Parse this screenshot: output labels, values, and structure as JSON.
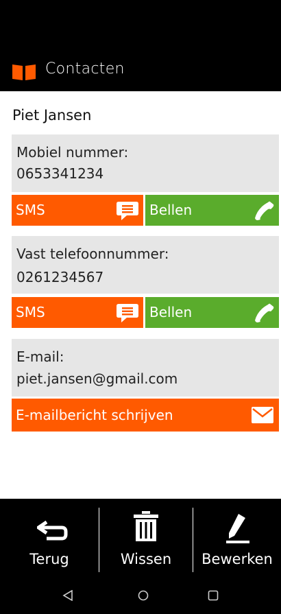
{
  "header": {
    "title": "Contacten",
    "icon": "book-icon"
  },
  "contact": {
    "name": "Piet Jansen",
    "mobile": {
      "label": "Mobiel nummer:",
      "value": "0653341234",
      "sms_label": "SMS",
      "call_label": "Bellen"
    },
    "landline": {
      "label": "Vast telefoonnummer:",
      "value": "0261234567",
      "sms_label": "SMS",
      "call_label": "Bellen"
    },
    "email": {
      "label": "E-mail:",
      "value": "piet.jansen@gmail.com",
      "write_label": "E-mailbericht schrijven"
    }
  },
  "bottom_bar": {
    "back_label": "Terug",
    "delete_label": "Wissen",
    "edit_label": "Bewerken"
  },
  "colors": {
    "accent_orange": "#ff5a00",
    "call_green": "#5aac2c",
    "card_gray": "#e6e6e6"
  }
}
